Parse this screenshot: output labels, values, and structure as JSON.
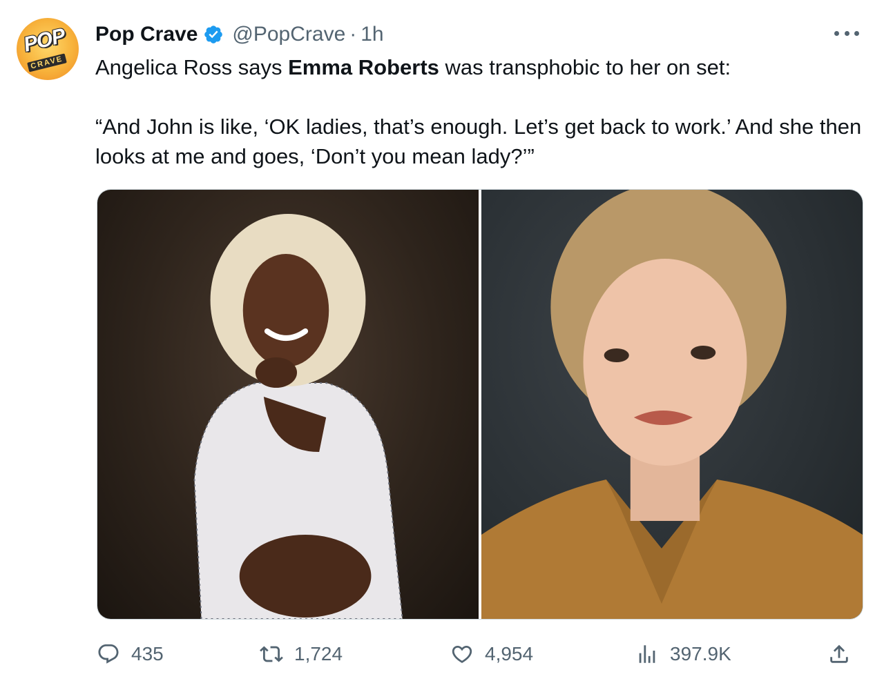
{
  "author": {
    "display_name": "Pop Crave",
    "handle": "@PopCrave",
    "separator": "·",
    "time": "1h",
    "verified": true,
    "avatar": {
      "logo_text": "POP",
      "logo_subtext": "CRAVE",
      "icon": "pop-crave-logo"
    }
  },
  "more_icon": "more-horizontal-icon",
  "tweet": {
    "line1_prefix": "Angelica Ross says ",
    "line1_bold": "Emma Roberts",
    "line1_suffix": " was transphobic to her on set:",
    "quote": "“And John is like, ‘OK ladies, that’s enough. Let’s get back to work.’ And she then looks at me and goes, ‘Don’t you mean lady?’”"
  },
  "media": {
    "count": 2,
    "left_photo": "portrait-photo",
    "right_photo": "portrait-photo"
  },
  "actions": {
    "replies": "435",
    "retweets": "1,724",
    "likes": "4,954",
    "views": "397.9K"
  },
  "colors": {
    "text": "#0f1419",
    "secondary": "#536471",
    "verified": "#1d9bf0",
    "border": "#cfd9de"
  }
}
